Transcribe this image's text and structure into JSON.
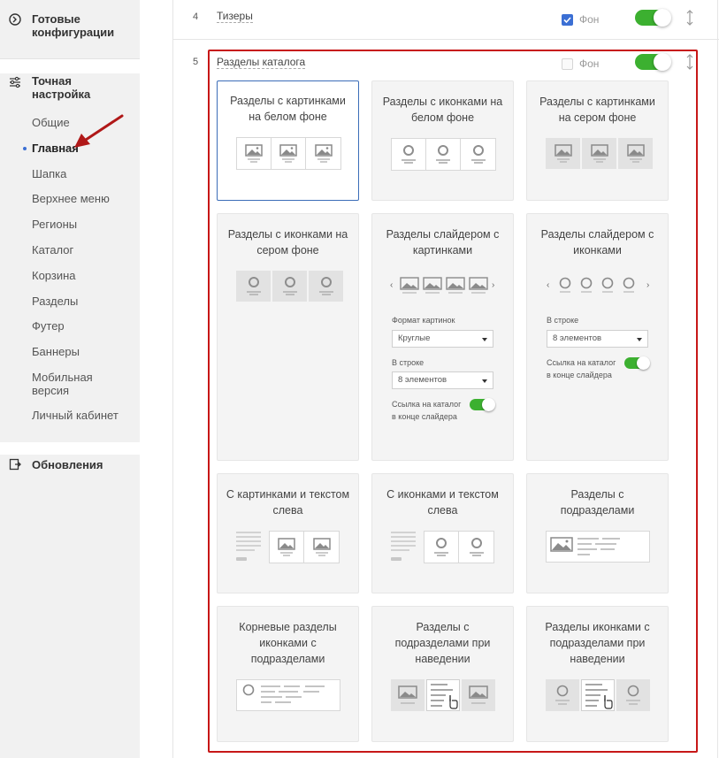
{
  "sidebar": {
    "ready_configs": "Готовые конфигурации",
    "fine_tuning": "Точная настройка",
    "updates": "Обновления",
    "items": [
      "Общие",
      "Главная",
      "Шапка",
      "Верхнее меню",
      "Регионы",
      "Каталог",
      "Корзина",
      "Разделы",
      "Футер",
      "Баннеры",
      "Мобильная версия",
      "Личный кабинет"
    ],
    "active_index": 1
  },
  "rows": [
    {
      "num": "4",
      "title": "Тизеры",
      "checkbox_label": "Фон",
      "checkbox_checked": true,
      "toggle_on": true
    },
    {
      "num": "5",
      "title": "Разделы каталога",
      "checkbox_label": "Фон",
      "checkbox_checked": false,
      "toggle_on": true
    }
  ],
  "cards": [
    {
      "title": "Разделы с картинками на белом фоне",
      "selected": true
    },
    {
      "title": "Разделы с иконками на белом фоне",
      "selected": false
    },
    {
      "title": "Разделы с картинками на сером фоне",
      "selected": false
    },
    {
      "title": "Разделы с иконками на сером фоне",
      "selected": false
    },
    {
      "title": "Разделы слайдером с картинками",
      "selected": false
    },
    {
      "title": "Разделы слайдером с иконками",
      "selected": false
    },
    {
      "title": "С картинками и текстом слева",
      "selected": false
    },
    {
      "title": "С иконками и текстом слева",
      "selected": false
    },
    {
      "title": "Разделы с подразделами",
      "selected": false
    },
    {
      "title": "Корневые разделы иконками с подразделами",
      "selected": false
    },
    {
      "title": "Разделы с подразделами при наведении",
      "selected": false
    },
    {
      "title": "Разделы иконками с подразделами при наведении",
      "selected": false
    }
  ],
  "slider_images": {
    "format_label": "Формат картинок",
    "format_value": "Круглые",
    "per_row_label": "В строке",
    "per_row_value": "8 элементов",
    "link_label": "Ссылка на каталог в конце слайдера",
    "link_on": true
  },
  "slider_icons": {
    "per_row_label": "В строке",
    "per_row_value": "8 элементов",
    "link_label": "Ссылка на каталог в конце слайдера",
    "link_on": true
  },
  "colors": {
    "accent": "#3b6fd4",
    "toggle": "#3cb030",
    "highlight": "#c71717"
  }
}
